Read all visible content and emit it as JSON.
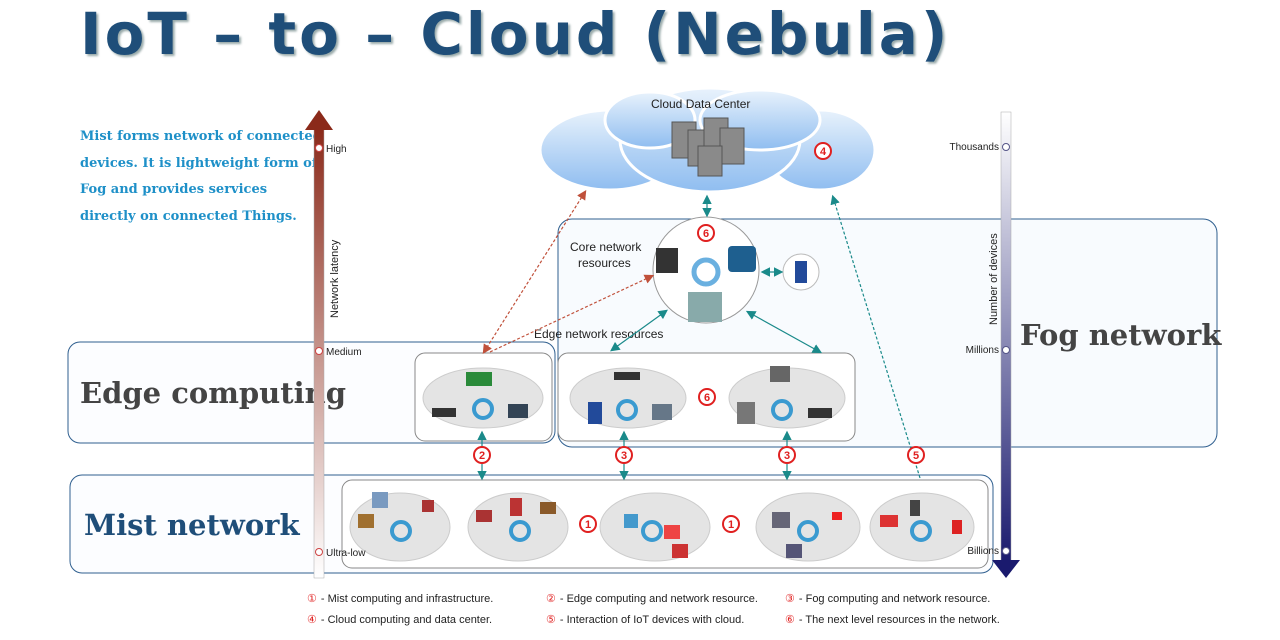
{
  "title": "IoT – to – Cloud (Nebula)",
  "mist_description": [
    "Mist forms network of connected",
    "devices. It is lightweight form of",
    "Fog and provides services",
    "directly on connected Things."
  ],
  "latency_axis": {
    "label": "Network latency",
    "ticks": [
      "High",
      "Medium",
      "Ultra-low"
    ],
    "color": "#8b2a1a"
  },
  "devices_axis": {
    "label": "Number of devices",
    "ticks": [
      "Thousands",
      "Millions",
      "Billions"
    ],
    "color": "#1a1a6e"
  },
  "cloud": {
    "label": "Cloud Data Center",
    "badge": "4"
  },
  "core": {
    "label_line1": "Core network",
    "label_line2": "resources",
    "badge": "6"
  },
  "edge_resources_label": "Edge network resources",
  "regions": {
    "fog": "Fog network",
    "edge": "Edge computing",
    "mist": "Mist network"
  },
  "badges": {
    "fog_cloud": "6",
    "edge_link": "2",
    "fog_link_a": "3",
    "fog_link_b": "3",
    "cloud_link": "5",
    "mist_a": "1",
    "mist_b": "1"
  },
  "legend": [
    {
      "num": "①",
      "text": "- Mist computing and infrastructure."
    },
    {
      "num": "②",
      "text": "- Edge computing and network resource."
    },
    {
      "num": "③",
      "text": "- Fog computing and network resource."
    },
    {
      "num": "④",
      "text": "- Cloud computing and data center."
    },
    {
      "num": "⑤",
      "text": "- Interaction of IoT devices with cloud."
    },
    {
      "num": "⑥",
      "text": "- The next level resources in the network."
    }
  ],
  "colors": {
    "title": "#1f4e79",
    "badge": "#e02020",
    "link": "#1a8a8a",
    "edge_link": "#c0503a",
    "box_border": "#2f5f8f"
  }
}
